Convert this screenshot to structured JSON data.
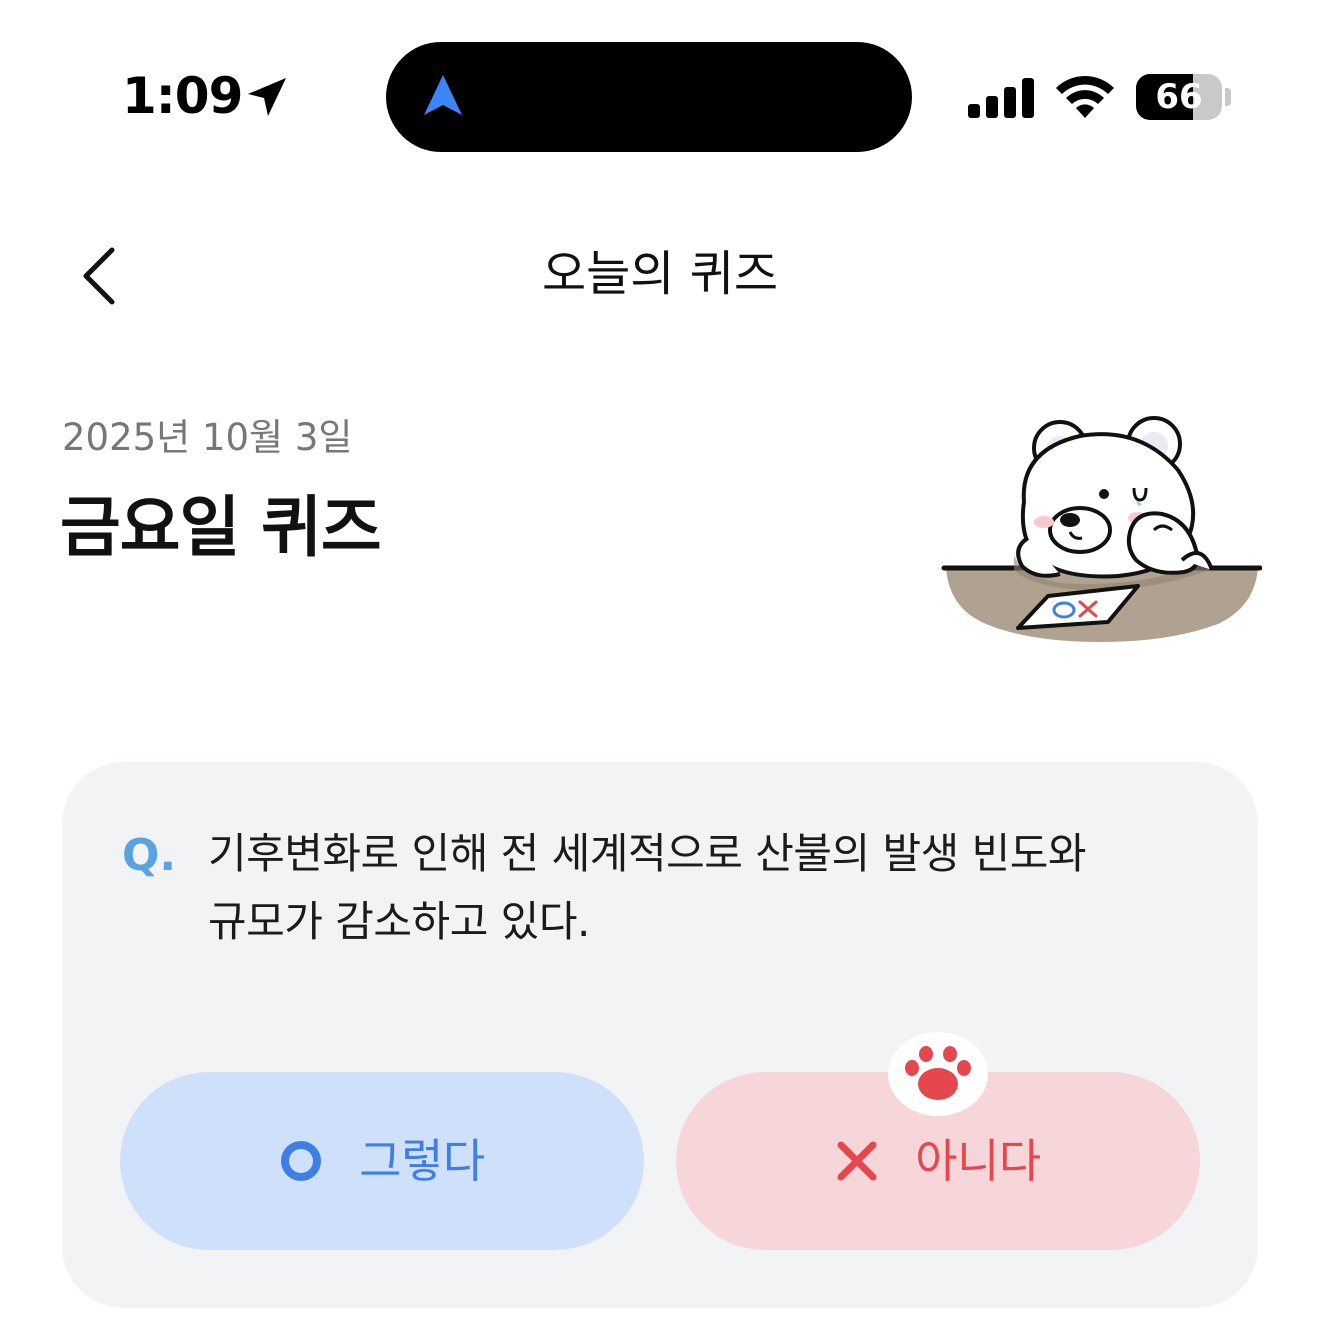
{
  "status_bar": {
    "time": "1:09",
    "battery": "66",
    "battery_level": 0.66
  },
  "nav": {
    "title": "오늘의 퀴즈"
  },
  "header": {
    "date": "2025년 10월 3일",
    "title": "금요일 퀴즈"
  },
  "quiz": {
    "q_mark": "Q.",
    "question_line1": "기후변화로 인해 전 세계적으로 산불의 발생 빈도와",
    "question_line2": "규모가 감소하고 있다.",
    "yes_label": "그렇다",
    "no_label": "아니다"
  },
  "colors": {
    "yes_bg": "#cfe0fa",
    "yes_fg": "#3f7fe4",
    "no_bg": "#f7d6d9",
    "no_fg": "#e5474e",
    "q_accent": "#5aa2e0"
  },
  "icons": {
    "location": "location-arrow-icon",
    "navigation": "navigation-arrow-icon",
    "signal": "cellular-signal-icon",
    "wifi": "wifi-icon",
    "back": "chevron-left-icon",
    "yes": "circle-o-icon",
    "no": "x-icon",
    "paw": "paw-icon"
  }
}
